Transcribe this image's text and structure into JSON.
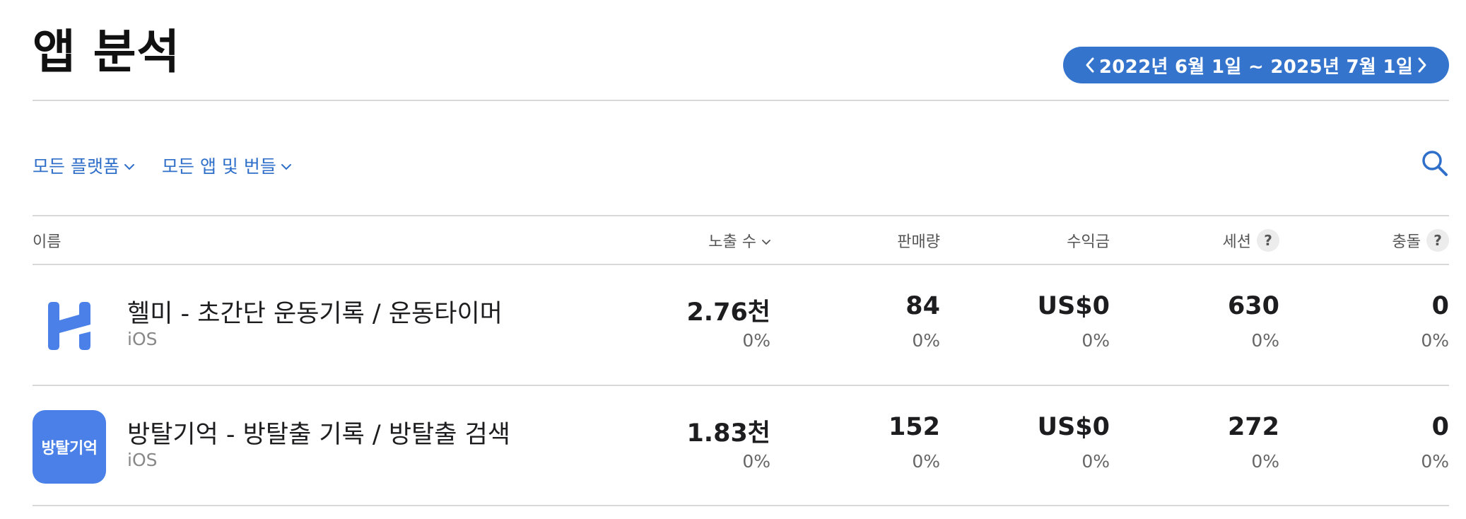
{
  "page": {
    "title": "앱 분석"
  },
  "date_range": {
    "label": "2022년 6월 1일 ~ 2025년 7월 1일",
    "accent": "#3574cc"
  },
  "filters": {
    "platform": "모든 플랫폼",
    "apps": "모든 앱 및 번들"
  },
  "columns": {
    "name": "이름",
    "impressions": "노출 수",
    "sales": "판매량",
    "proceeds": "수익금",
    "sessions": "세션",
    "crashes": "충돌",
    "help": "?"
  },
  "rows": [
    {
      "icon": "helmi-app-icon",
      "name": "헬미 - 초간단 운동기록 / 운동타이머",
      "platform": "iOS",
      "impressions": "2.76천",
      "impressions_pct": "0%",
      "sales": "84",
      "sales_pct": "0%",
      "proceeds": "US$0",
      "proceeds_pct": "0%",
      "sessions": "630",
      "sessions_pct": "0%",
      "crashes": "0",
      "crashes_pct": "0%"
    },
    {
      "icon": "bangtal-app-icon",
      "icon_text": "방탈기억",
      "name": "방탈기억 - 방탈출 기록 / 방탈출 검색",
      "platform": "iOS",
      "impressions": "1.83천",
      "impressions_pct": "0%",
      "sales": "152",
      "sales_pct": "0%",
      "proceeds": "US$0",
      "proceeds_pct": "0%",
      "sessions": "272",
      "sessions_pct": "0%",
      "crashes": "0",
      "crashes_pct": "0%"
    }
  ],
  "colors": {
    "link": "#2f6fc9",
    "icon_blue": "#4a80e8"
  }
}
